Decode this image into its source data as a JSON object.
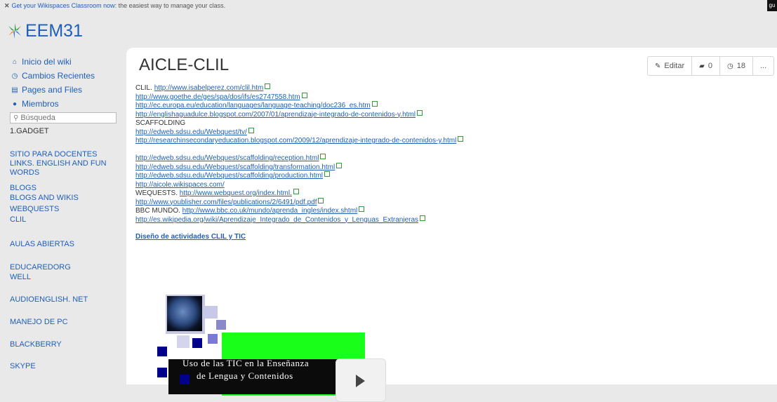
{
  "promo": {
    "close_glyph": "✕",
    "link_text": "Get your Wikispaces Classroom now:",
    "rest_text": " the easiest way to manage your class.",
    "corner_text": "gu"
  },
  "site": {
    "title": "EEM31"
  },
  "nav": [
    {
      "icon": "home-icon",
      "glyph": "⌂",
      "label": "Inicio del wiki"
    },
    {
      "icon": "clock-icon",
      "glyph": "◷",
      "label": "Cambios Recientes"
    },
    {
      "icon": "page-icon",
      "glyph": "▤",
      "label": "Pages and Files"
    },
    {
      "icon": "user-icon",
      "glyph": "●",
      "label": "Miembros"
    }
  ],
  "search": {
    "placeholder": "Búsqueda"
  },
  "sidebar": {
    "gadget_label": "1.GADGET",
    "links": [
      "SITIO PARA DOCENTES",
      "LINKS. ENGLISH AND FUN",
      "WORDS",
      "BLOGS",
      "BLOGS AND WIKIS",
      "WEBQUESTS",
      "CLIL",
      "AULAS ABIERTAS",
      "EDUCAREDORG",
      "WELL",
      "AUDIOENGLISH. NET",
      "MANEJO DE PC",
      "BLACKBERRY",
      "SKYPE"
    ]
  },
  "page": {
    "title": "AICLE-CLIL",
    "toolbar": {
      "edit_label": "Editar",
      "comments_count": "0",
      "history_count": "18",
      "more_label": "..."
    },
    "lines": [
      {
        "label": "CLIL. ",
        "link": "http://www.isabelperez.com/clil.htm"
      },
      {
        "label": "",
        "link": "http://www.goethe.de/ges/spa/dos/ifs/es2747558.htm"
      },
      {
        "label": "",
        "link": "http://ec.europa.eu/education/languages/language-teaching/doc236_es.htm"
      },
      {
        "label": "",
        "link": "http://englishaguadulce.blogspot.com/2007/01/aprendizaje-integrado-de-contenidos-y.html"
      },
      {
        "label": "SCAFFOLDING",
        "link": ""
      },
      {
        "label": "",
        "link": "http://edweb.sdsu.edu/Webquest/tv/"
      },
      {
        "label": "",
        "link": "http://researchinsecondaryeducation.blogspot.com/2009/12/aprendizaje-integrado-de-contenidos-y.html"
      },
      {
        "label": "",
        "link": ""
      },
      {
        "label": "",
        "link": "http://edweb.sdsu.edu/Webquest/scaffolding/reception.html"
      },
      {
        "label": "",
        "link": "http://edweb.sdsu.edu/Webquest/scaffolding/transformation.html"
      },
      {
        "label": "",
        "link": "http://edweb.sdsu.edu/Webquest/scaffolding/production.html"
      },
      {
        "label": "",
        "link": "http://aicole.wikispaces.com/"
      },
      {
        "label": "WEQUESTS. ",
        "link": "http://www.webquest.org/index.html."
      },
      {
        "label": "",
        "link": "http://www.youblisher.com/files/publications/2/6491/pdf.pdf"
      },
      {
        "label": "BBC MUNDO. ",
        "link": "http://www.bbc.co.uk/mundo/aprenda_ingles/index.shtml"
      },
      {
        "label": "",
        "link": "http://es.wikipedia.org/wiki/Aprendizaje_Integrado_de_Contenidos_y_Lenguas_Extranjeras"
      }
    ],
    "bold_link": "Diseño de actividades CLIL y TIC",
    "video": {
      "caption_line1": "Uso de las TIC en la Enseñanza",
      "caption_line2": "de Lengua y Contenidos"
    }
  },
  "colors": {
    "link": "#1f5fb8",
    "background": "#e9e9e9",
    "video_green": "#19ff19",
    "video_navy": "#00008b"
  }
}
